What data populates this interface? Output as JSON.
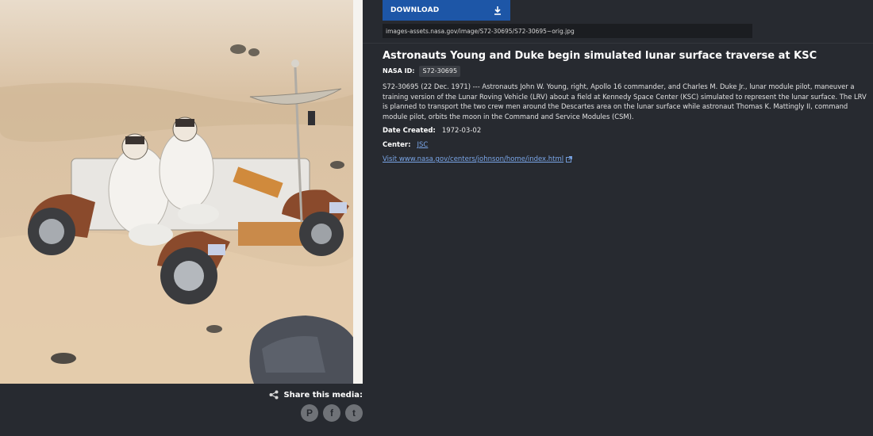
{
  "download": {
    "label": "DOWNLOAD",
    "icon": "download-icon"
  },
  "image_url": "images-assets.nasa.gov/image/S72-30695/S72-30695~orig.jpg",
  "title": "Astronauts Young and Duke begin simulated lunar surface traverse at KSC",
  "nasa_id": {
    "label": "NASA ID:",
    "value": "S72-30695"
  },
  "description": "S72-30695 (22 Dec. 1971) --- Astronauts John W. Young, right, Apollo 16 commander, and Charles M. Duke Jr., lunar module pilot, maneuver a training version of the Lunar Roving Vehicle (LRV) about a field at Kennedy Space Center (KSC) simulated to represent the lunar surface. The LRV is planned to transport the two crew men around the Descartes area on the lunar surface while astronaut Thomas K. Mattingly II, command module pilot, orbits the moon in the Command and Service Modules (CSM).",
  "date_created": {
    "label": "Date Created:",
    "value": "1972-03-02"
  },
  "center": {
    "label": "Center:",
    "value": "JSC"
  },
  "external_link": "Visit www.nasa.gov/centers/johnson/home/index.html",
  "share": {
    "label": "Share this media:",
    "icons": [
      "pinterest-icon",
      "facebook-icon",
      "twitter-icon"
    ],
    "pinterest_glyph": "P",
    "facebook_glyph": "f",
    "twitter_glyph": "t"
  },
  "colors": {
    "background": "#272a30",
    "accent": "#1d56a7",
    "link": "#7aa6e8"
  }
}
